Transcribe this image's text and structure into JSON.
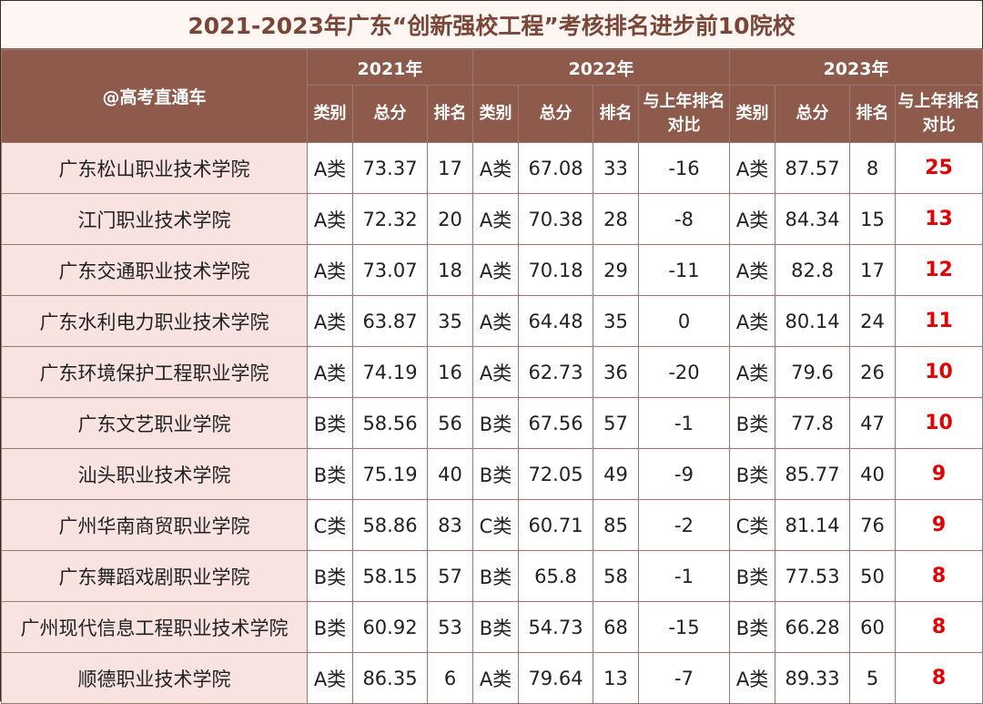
{
  "title": "2021-2023年广东“创新强校工程”考核排名进步前10院校",
  "brand": "@高考直通车",
  "years": [
    "2021年",
    "2022年",
    "2023年"
  ],
  "headers": {
    "category": "类别",
    "score": "总分",
    "rank": "排名",
    "compare": "与上年排名对比"
  },
  "rows": [
    {
      "school": "广东松山职业技术学院",
      "c21": "A类",
      "s21": "73.37",
      "r21": "17",
      "c22": "A类",
      "s22": "67.08",
      "r22": "33",
      "d22": "-16",
      "c23": "A类",
      "s23": "87.57",
      "r23": "8",
      "d23": "25"
    },
    {
      "school": "江门职业技术学院",
      "c21": "A类",
      "s21": "72.32",
      "r21": "20",
      "c22": "A类",
      "s22": "70.38",
      "r22": "28",
      "d22": "-8",
      "c23": "A类",
      "s23": "84.34",
      "r23": "15",
      "d23": "13"
    },
    {
      "school": "广东交通职业技术学院",
      "c21": "A类",
      "s21": "73.07",
      "r21": "18",
      "c22": "A类",
      "s22": "70.18",
      "r22": "29",
      "d22": "-11",
      "c23": "A类",
      "s23": "82.8",
      "r23": "17",
      "d23": "12"
    },
    {
      "school": "广东水利电力职业技术学院",
      "c21": "A类",
      "s21": "63.87",
      "r21": "35",
      "c22": "A类",
      "s22": "64.48",
      "r22": "35",
      "d22": "0",
      "c23": "A类",
      "s23": "80.14",
      "r23": "24",
      "d23": "11"
    },
    {
      "school": "广东环境保护工程职业学院",
      "c21": "A类",
      "s21": "74.19",
      "r21": "16",
      "c22": "A类",
      "s22": "62.73",
      "r22": "36",
      "d22": "-20",
      "c23": "A类",
      "s23": "79.6",
      "r23": "26",
      "d23": "10"
    },
    {
      "school": "广东文艺职业学院",
      "c21": "B类",
      "s21": "58.56",
      "r21": "56",
      "c22": "B类",
      "s22": "67.56",
      "r22": "57",
      "d22": "-1",
      "c23": "B类",
      "s23": "77.8",
      "r23": "47",
      "d23": "10"
    },
    {
      "school": "汕头职业技术学院",
      "c21": "B类",
      "s21": "75.19",
      "r21": "40",
      "c22": "B类",
      "s22": "72.05",
      "r22": "49",
      "d22": "-9",
      "c23": "B类",
      "s23": "85.77",
      "r23": "40",
      "d23": "9"
    },
    {
      "school": "广州华南商贸职业学院",
      "c21": "C类",
      "s21": "58.86",
      "r21": "83",
      "c22": "C类",
      "s22": "60.71",
      "r22": "85",
      "d22": "-2",
      "c23": "C类",
      "s23": "81.14",
      "r23": "76",
      "d23": "9"
    },
    {
      "school": "广东舞蹈戏剧职业学院",
      "c21": "B类",
      "s21": "58.15",
      "r21": "57",
      "c22": "B类",
      "s22": "65.8",
      "r22": "58",
      "d22": "-1",
      "c23": "B类",
      "s23": "77.53",
      "r23": "50",
      "d23": "8"
    },
    {
      "school": "广州现代信息工程职业技术学院",
      "c21": "B类",
      "s21": "60.92",
      "r21": "53",
      "c22": "B类",
      "s22": "54.73",
      "r22": "68",
      "d22": "-15",
      "c23": "B类",
      "s23": "66.28",
      "r23": "60",
      "d23": "8"
    },
    {
      "school": "顺德职业技术学院",
      "c21": "A类",
      "s21": "86.35",
      "r21": "6",
      "c22": "A类",
      "s22": "79.64",
      "r22": "13",
      "d22": "-7",
      "c23": "A类",
      "s23": "89.33",
      "r23": "5",
      "d23": "8"
    }
  ]
}
